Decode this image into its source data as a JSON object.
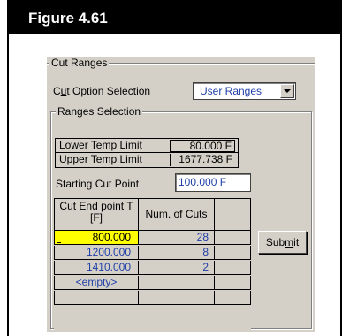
{
  "figure": {
    "title": "Figure 4.61"
  },
  "cut_ranges": {
    "group_title": "Cut Ranges",
    "cut_option_label_pre": "C",
    "cut_option_label_u": "u",
    "cut_option_label_post": "t Option Selection",
    "cut_option_value": "User Ranges",
    "ranges_group_title": "Ranges Selection",
    "lower_temp_label": "Lower Temp Limit",
    "lower_temp_value": "80.000 F",
    "upper_temp_label": "Upper Temp Limit",
    "upper_temp_value": "1677.738 F",
    "starting_cut_label": "Starting Cut Point",
    "starting_cut_value": "100.000 F",
    "table": {
      "col1_header": "Cut End point T [F]",
      "col2_header": "Num. of Cuts",
      "rows": [
        {
          "end_point": "800.000",
          "cuts": "28"
        },
        {
          "end_point": "1200.000",
          "cuts": "8"
        },
        {
          "end_point": "1410.000",
          "cuts": "2"
        },
        {
          "end_point": "<empty>",
          "cuts": ""
        }
      ]
    },
    "submit_pre": "Sub",
    "submit_u": "m",
    "submit_post": "it"
  }
}
